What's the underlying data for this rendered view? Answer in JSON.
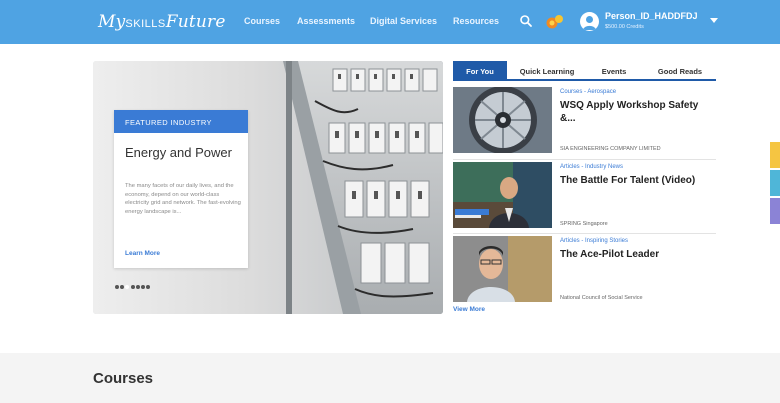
{
  "header": {
    "logo_prefix": "My",
    "logo_skills": "SKILLS",
    "logo_suffix": "Future",
    "nav": [
      "Courses",
      "Assessments",
      "Digital Services",
      "Resources"
    ],
    "icons": {
      "search": "search-icon",
      "notifications": "notification-icon",
      "avatar": "user-avatar-icon",
      "menu": "chevron-down-icon"
    },
    "user_name": "Person_ID_HADDFDJ",
    "user_credits": "$500.00 Credits"
  },
  "featured": {
    "label": "FEATURED INDUSTRY",
    "title": "Energy and Power",
    "description": "The many facets of our daily lives, and the economy, depend on our world-class electricity grid and network. The fast-evolving energy landscape is...",
    "link": "Learn More"
  },
  "tabs": [
    {
      "label": "For You",
      "active": true
    },
    {
      "label": "Quick Learning",
      "active": false
    },
    {
      "label": "Events",
      "active": false
    },
    {
      "label": "Good Reads",
      "active": false
    }
  ],
  "articles": [
    {
      "category": "Courses - Aerospace",
      "title": "WSQ Apply Workshop Safety &...",
      "source": "SIA ENGINEERING COMPANY LIMITED"
    },
    {
      "category": "Articles - Industry News",
      "title": "The Battle For Talent (Video)",
      "source": "SPRING Singapore"
    },
    {
      "category": "Articles - Inspiring Stories",
      "title": "The Ace-Pilot Leader",
      "source": "National Council of Social Service"
    }
  ],
  "view_more": "View More",
  "courses": {
    "title": "Courses"
  },
  "colors": {
    "header": "#4fa3e3",
    "primary": "#3a7bd5",
    "tab_active": "#1f5aa8"
  }
}
